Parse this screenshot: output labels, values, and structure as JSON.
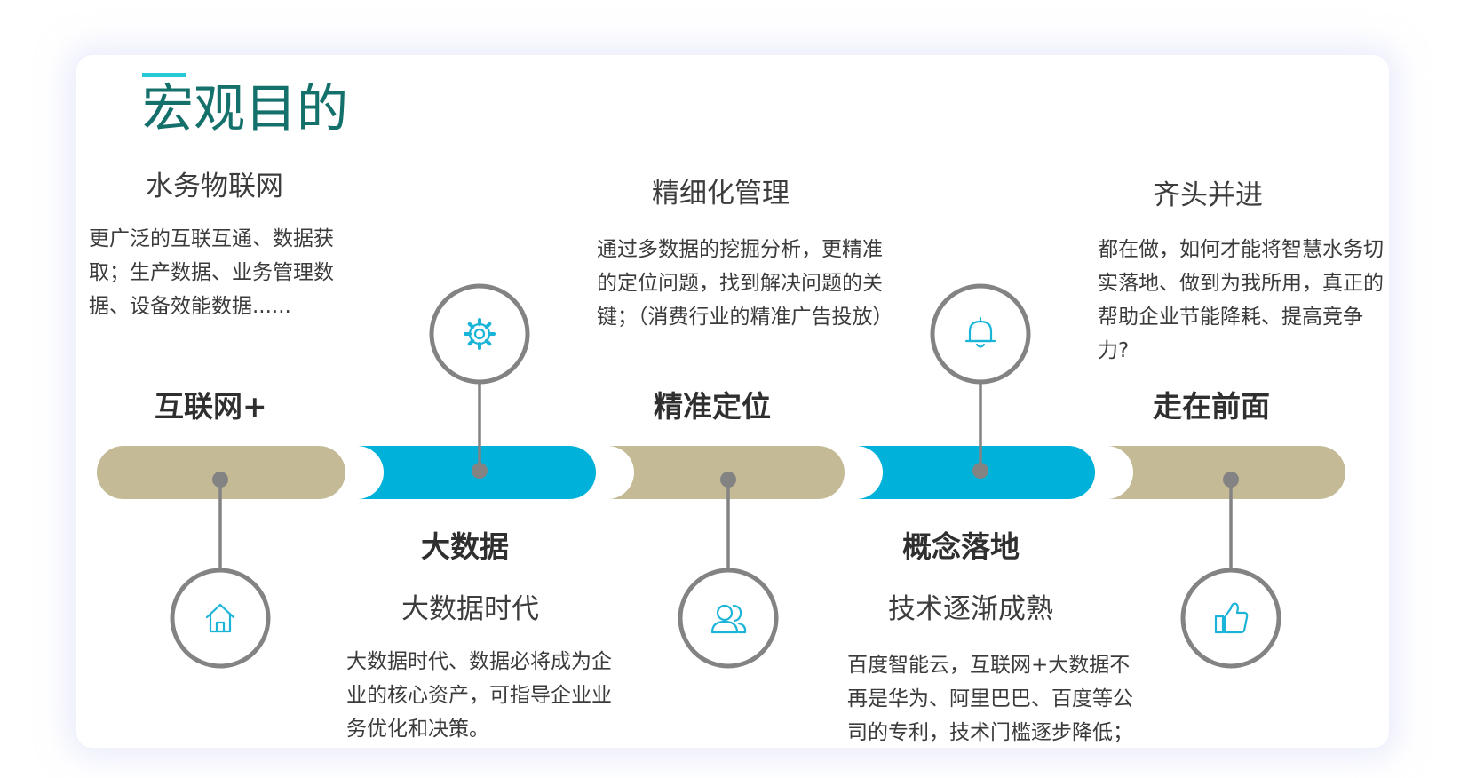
{
  "page": {
    "title": "宏观目的"
  },
  "colors": {
    "title": "#13706b",
    "accent": "#27c9d4",
    "tan": "#c4bb96",
    "cyan": "#00b1da",
    "stem": "#838383",
    "icon": "#1ab4d8"
  },
  "stages": [
    {
      "heading": "互联网+",
      "subtitle": "水务物联网",
      "text": "更广泛的互联互通、数据获取；生产数据、业务管理数据、设备效能数据......",
      "icon": "home-icon",
      "color": "tan"
    },
    {
      "heading": "大数据",
      "subtitle": "大数据时代",
      "text": "大数据时代、数据必将成为企业的核心资产，可指导企业业务优化和决策。",
      "icon": "gear-icon",
      "color": "cyan"
    },
    {
      "heading": "精准定位",
      "subtitle": "精细化管理",
      "text": "通过多数据的挖掘分析，更精准的定位问题，找到解决问题的关键；（消费行业的精准广告投放）",
      "icon": "users-icon",
      "color": "tan"
    },
    {
      "heading": "概念落地",
      "subtitle": "技术逐渐成熟",
      "text": "百度智能云，互联网+大数据不再是华为、阿里巴巴、百度等公司的专利，技术门槛逐步降低；",
      "icon": "bell-icon",
      "color": "cyan"
    },
    {
      "heading": "走在前面",
      "subtitle": "齐头并进",
      "text": "都在做，如何才能将智慧水务切实落地、做到为我所用，真正的帮助企业节能降耗、提高竞争力?",
      "icon": "thumbs-up-icon",
      "color": "tan"
    }
  ]
}
